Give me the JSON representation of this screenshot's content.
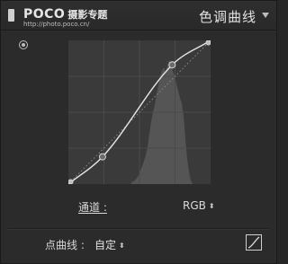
{
  "header": {
    "watermark_brand": "POCO",
    "watermark_brand_sub": "摄影专题",
    "watermark_url": "http://photo.poco.cn/",
    "title": "色调曲线"
  },
  "channel": {
    "label": "通道 :",
    "value": "RGB",
    "arrows": "⬍"
  },
  "point_curve": {
    "label": "点曲线 :",
    "value": "自定",
    "arrows": "⬍"
  },
  "curve": {
    "points": [
      [
        0,
        0
      ],
      [
        0.24,
        0.19
      ],
      [
        0.73,
        0.83
      ],
      [
        1,
        1
      ]
    ],
    "background": "#3a3a3a",
    "curve_color": "#e6e6e6",
    "histogram_color": "#555555"
  },
  "icons": {
    "collapse": "collapse-handle-icon",
    "targeted_adjustment": "target-adjust-icon",
    "edit_point_curve": "edit-point-curve-icon"
  }
}
